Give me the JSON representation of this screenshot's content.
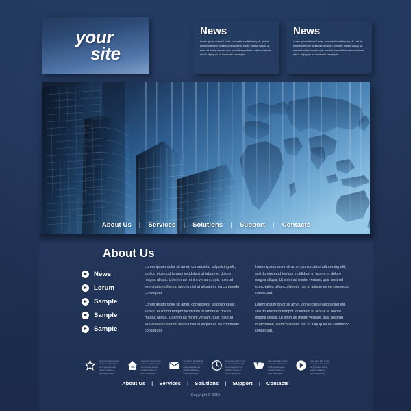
{
  "site": {
    "logo_line1": "your",
    "logo_line2": "site"
  },
  "header": {
    "news_boxes": [
      {
        "title": "News",
        "body": "Lorem ipsum dolor sit amet, consectetur adipisicing elit, sed do eiusmod tempor incididunt ut labore et dolore magna aliqua. Ut enim ad minim veniam, quis nostrud exercitation ullamco laboris nisi ut aliquip ex ea commodo consequat."
      },
      {
        "title": "News",
        "body": "Lorem ipsum dolor sit amet, consectetur adipisicing elit, sed do eiusmod tempor incididunt ut labore et dolore magna aliqua. Ut enim ad minim veniam, quis nostrud exercitation ullamco laboris nisi ut aliquip ex ea commodo consequat."
      }
    ]
  },
  "hero": {
    "nav": [
      {
        "label": "About Us"
      },
      {
        "label": "Services"
      },
      {
        "label": "Solutions"
      },
      {
        "label": "Support"
      },
      {
        "label": "Contacts"
      }
    ],
    "separator": "|",
    "image_description": "city skyscrapers fading into blue world map background"
  },
  "main": {
    "section_title": "About Us",
    "side_list": [
      {
        "label": "News",
        "icon": "play-circle-icon"
      },
      {
        "label": "Lorum",
        "icon": "play-circle-icon"
      },
      {
        "label": "Sample",
        "icon": "play-circle-icon"
      },
      {
        "label": "Sample",
        "icon": "play-circle-icon"
      },
      {
        "label": "Sample",
        "icon": "play-circle-icon"
      }
    ],
    "columns": [
      {
        "paragraphs": [
          "Lorem ipsum dolor sit amet, consectetur adipisicing elit, sed do eiusmod tempor incididunt ut labore et dolore magna aliqua. Ut enim ad minim veniam, quis nostrud exercitation ullamco laboris nisi ut aliquip ex ea commodo consequat.",
          "Lorem ipsum dolor sit amet, consectetur adipisicing elit, sed do eiusmod tempor incididunt ut labore et dolore magna aliqua. Ut enim ad minim veniam, quis nostrud exercitation ullamco laboris nisi ut aliquip ex ea commodo consequat."
        ]
      },
      {
        "paragraphs": [
          "Lorem ipsum dolor sit amet, consectetur adipisicing elit, sed do eiusmod tempor incididunt ut labore et dolore magna aliqua. Ut enim ad minim veniam, quis nostrud exercitation ullamco laboris nisi ut aliquip ex ea commodo consequat.",
          "Lorem ipsum dolor sit amet, consectetur adipisicing elit, sed do eiusmod tempor incididunt ut labore et dolore magna aliqua. Ut enim ad minim veniam, quis nostrud exercitation ullamco laboris nisi ut aliquip ex ea commodo consequat."
        ]
      }
    ]
  },
  "footer": {
    "feature_items": [
      {
        "icon": "star-icon",
        "text": "Lorem ipsum dolor sit amet, consectetur adipisicing elit, sed do eiusmod tempor incididunt ut labore et dolore magna aliqua"
      },
      {
        "icon": "home-icon",
        "text": "Lorem ipsum dolor sit amet, consectetur adipisicing elit, sed do eiusmod tempor incididunt ut labore et dolore magna aliqua"
      },
      {
        "icon": "envelope-icon",
        "text": "Lorem ipsum dolor sit amet, consectetur adipisicing elit, sed do eiusmod tempor incididunt ut labore et dolore magna aliqua"
      },
      {
        "icon": "clock-icon",
        "text": "Lorem ipsum dolor sit amet, consectetur adipisicing elit, sed do eiusmod tempor incididunt ut labore et dolore magna aliqua"
      },
      {
        "icon": "ribbon-icon",
        "text": "Lorem ipsum dolor sit amet, consectetur adipisicing elit, sed do eiusmod tempor incididunt ut labore et dolore magna aliqua"
      },
      {
        "icon": "play-circle-icon",
        "text": "Lorem ipsum dolor sit amet, consectetur adipisicing elit, sed do eiusmod tempor incididunt ut labore et dolore magna aliqua"
      }
    ],
    "nav": [
      {
        "label": "About Us"
      },
      {
        "label": "Services"
      },
      {
        "label": "Solutions"
      },
      {
        "label": "Support"
      },
      {
        "label": "Contacts"
      }
    ],
    "separator": "|",
    "copyright": "Copyright © 2010"
  },
  "colors": {
    "page_background": "#1e3052",
    "panel_background": "#24375c",
    "accent_light_blue": "#6e8fbb",
    "hero_blue": "#417aad",
    "text_white": "#ffffff",
    "text_muted": "#c9d7e8"
  }
}
